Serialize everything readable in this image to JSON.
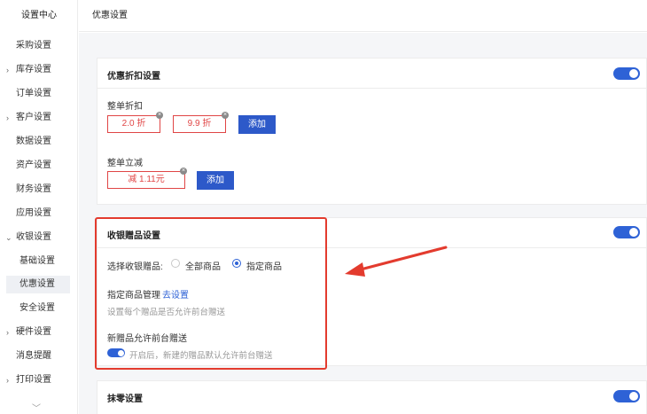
{
  "sidebar": {
    "title": "设置中心",
    "items": [
      {
        "label": "采购设置"
      },
      {
        "label": "库存设置",
        "arrow": "›"
      },
      {
        "label": "订单设置"
      },
      {
        "label": "客户设置",
        "arrow": "›"
      },
      {
        "label": "数据设置"
      },
      {
        "label": "资产设置"
      },
      {
        "label": "财务设置"
      },
      {
        "label": "应用设置"
      },
      {
        "label": "收银设置",
        "arrow": "⌄"
      },
      {
        "label": "基础设置"
      },
      {
        "label": "优惠设置"
      },
      {
        "label": "安全设置"
      },
      {
        "label": "硬件设置",
        "arrow": "›"
      },
      {
        "label": "消息提醒"
      },
      {
        "label": "打印设置",
        "arrow": "›"
      }
    ],
    "more": "﹀"
  },
  "header": {
    "title": "优惠设置"
  },
  "discount_card": {
    "title": "优惠折扣设置",
    "whole_discount_label": "整单折扣",
    "tags": [
      "2.0 折",
      "9.9 折"
    ],
    "add_label": "添加",
    "whole_reduce_label": "整单立减",
    "reduce_tag": "减 1.11元",
    "add_label_2": "添加",
    "close_glyph": "×"
  },
  "gift_card": {
    "title": "收银赠品设置",
    "select_label": "选择收银赠品:",
    "option_all": "全部商品",
    "option_specified": "指定商品",
    "manage_label": "指定商品管理",
    "manage_link": "去设置",
    "manage_hint": "设置每个赠品是否允许前台赠送",
    "new_gift_label": "新赠品允许前台赠送",
    "new_gift_hint": "开启后，新建的赠品默认允许前台赠送"
  },
  "rounding_card": {
    "title": "抹零设置"
  },
  "colors": {
    "accent": "#2e62d6",
    "danger": "#e04545",
    "annotation": "#e33b2e"
  }
}
